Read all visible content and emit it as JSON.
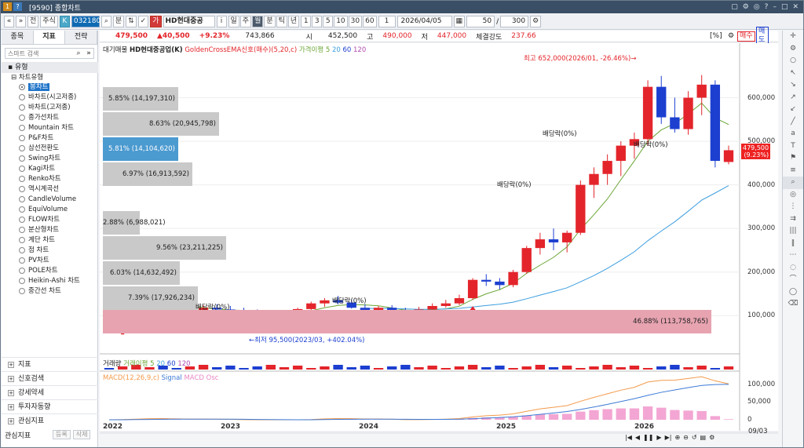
{
  "window": {
    "title": "[9590] 종합차트",
    "title_icons": [
      "restore-icon",
      "options-icon",
      "snapshot-icon",
      "help-icon",
      "minimize-icon",
      "maximize-icon",
      "close-icon"
    ]
  },
  "toolbar": {
    "nav_prev": "«",
    "nav_next": "»",
    "market1": "전",
    "market2": "주식",
    "k_badge": "K",
    "code": "032180",
    "search_icon": "⌕",
    "btn_prev": "분",
    "btn_updown": "⇅",
    "chk_icon": "✓",
    "name_badge": "가",
    "stock_name": "HD현대중공",
    "info_icon": "i",
    "periods": [
      "일",
      "주",
      "월",
      "분",
      "틱",
      "년"
    ],
    "active_period": "월",
    "intervals": [
      "1",
      "3",
      "5",
      "10",
      "30",
      "60"
    ],
    "count_sel": "1",
    "date": "2026/04/05",
    "qty": "50",
    "slash": "/",
    "max_bars": "300",
    "settings_icon": "⚙"
  },
  "left_pane": {
    "tabs": [
      "종목",
      "지표",
      "전략"
    ],
    "active_tab": "지표",
    "search_placeholder": "스마트 검색",
    "tree_header": "유형",
    "tree_group": "차트유형",
    "items": [
      "봉차트",
      "바차트(시고저종)",
      "바차트(고저종)",
      "종가선차트",
      "Mountain 차트",
      "P&F차트",
      "삼선전환도",
      "Swing차트",
      "Kagi차트",
      "Renko차트",
      "역시계곡선",
      "CandleVolume",
      "EquiVolume",
      "FLOW차트",
      "분산형차트",
      "계단 차트",
      "점 차트",
      "PV차트",
      "POLE차트",
      "Heikin-Ashi 차트",
      "중간선 차트"
    ],
    "selected_item": "봉차트",
    "sections": [
      "지표",
      "신호검색",
      "강세약세",
      "투자자동향",
      "관심지표"
    ],
    "fav_label": "관심지표",
    "fav_add": "등록",
    "fav_del": "삭제"
  },
  "quote": {
    "price": "479,500",
    "change": "▲40,500",
    "pct": "+9.23%",
    "volume": "743,866",
    "open_label": "시",
    "open": "452,500",
    "high_label": "고",
    "high": "490,000",
    "low_label": "저",
    "low": "447,000",
    "strength_label": "체결강도",
    "strength": "237.66",
    "ratio_btn": "[%]",
    "buy_btn": "매수",
    "sell_btn": "매도"
  },
  "legend": {
    "main": [
      "대기매물",
      "HD현대중공업(K)",
      "GoldenCrossEMA신호(매수)(5,20,c)",
      "가격이평 5",
      "20",
      "60",
      "120"
    ],
    "vol": [
      "거래량",
      "거래이평 5",
      "20",
      "60",
      "120"
    ],
    "macd": [
      "MACD(12,26,9,c)",
      "Signal",
      "MACD Osc"
    ]
  },
  "colors": {
    "up": "#e3252b",
    "down": "#1c3fd0",
    "ma5": "#6aa534",
    "ma20": "#3d9ee0",
    "macd": "#f39a4b",
    "signal": "#3d7ad6",
    "osc": "#f3a6d3",
    "volume_profile": "#c9c9c9",
    "volume_profile_highlight": "#e7a3b0"
  },
  "annotations": {
    "high": "최고 652,000(2026/01, -26.46%)→",
    "low": "←최저 95,500(2023/03, +402.04%)",
    "div1": "배당락(0%)",
    "div2": "배당락(0%)",
    "div3": "배당락(0%)",
    "div4": "배당락(0%)",
    "div5": "배당락(0%)",
    "price_tag_value": "479,500",
    "price_tag_pct": "(9.23%)"
  },
  "volume_profile": [
    {
      "label": "5.85% (14,197,310)"
    },
    {
      "label": "8.63% (20,945,798)"
    },
    {
      "label": "5.81% (14,104,620)"
    },
    {
      "label": "6.97% (16,913,592)"
    },
    {
      "label": "2.88% (6,988,021)"
    },
    {
      "label": "9.56% (23,211,225)"
    },
    {
      "label": "6.03% (14,632,492)"
    },
    {
      "label": "7.39% (17,926,234)"
    },
    {
      "label": "46.88% (113,758,765)"
    }
  ],
  "axis": {
    "price_ticks": [
      "600,000",
      "500,000",
      "400,000",
      "300,000",
      "200,000",
      "100,000"
    ],
    "macd_ticks": [
      "100,000",
      "50,000",
      "0"
    ],
    "x_labels": [
      "2022",
      "2023",
      "2024",
      "2025",
      "2026"
    ],
    "last_date": "09/03",
    "cursor_date": "09/03"
  },
  "chart_data": {
    "type": "candlestick",
    "period": "monthly",
    "ylim": [
      50000,
      700000
    ],
    "candles": [
      [
        120000,
        140000,
        100000,
        110000
      ],
      [
        110000,
        125000,
        100000,
        118000
      ],
      [
        118000,
        130000,
        110000,
        125000
      ],
      [
        125000,
        140000,
        115000,
        130000
      ],
      [
        130000,
        142000,
        118000,
        122000
      ],
      [
        122000,
        132000,
        105000,
        110000
      ],
      [
        110000,
        120000,
        102000,
        112000
      ],
      [
        112000,
        124000,
        106000,
        118000
      ],
      [
        118000,
        126000,
        108000,
        114000
      ],
      [
        114000,
        122000,
        105000,
        110000
      ],
      [
        110000,
        118000,
        102000,
        106000
      ],
      [
        106000,
        114000,
        98000,
        100000
      ],
      [
        100000,
        108000,
        95500,
        104000
      ],
      [
        104000,
        112000,
        98000,
        108000
      ],
      [
        108000,
        118000,
        102000,
        115000
      ],
      [
        115000,
        132000,
        110000,
        128000
      ],
      [
        128000,
        140000,
        120000,
        135000
      ],
      [
        135000,
        145000,
        126000,
        130000
      ],
      [
        130000,
        136000,
        116000,
        118000
      ],
      [
        118000,
        126000,
        108000,
        112000
      ],
      [
        112000,
        122000,
        104000,
        118000
      ],
      [
        118000,
        124000,
        106000,
        110000
      ],
      [
        110000,
        118000,
        100000,
        104000
      ],
      [
        104000,
        120000,
        100000,
        114000
      ],
      [
        114000,
        128000,
        110000,
        122000
      ],
      [
        122000,
        136000,
        118000,
        128000
      ],
      [
        128000,
        148000,
        124000,
        140000
      ],
      [
        140000,
        186000,
        136000,
        182000
      ],
      [
        182000,
        195000,
        168000,
        178000
      ],
      [
        178000,
        186000,
        160000,
        170000
      ],
      [
        170000,
        205000,
        165000,
        200000
      ],
      [
        200000,
        260000,
        196000,
        255000
      ],
      [
        255000,
        290000,
        240000,
        275000
      ],
      [
        275000,
        300000,
        250000,
        268000
      ],
      [
        268000,
        295000,
        245000,
        290000
      ],
      [
        290000,
        410000,
        285000,
        400000
      ],
      [
        400000,
        440000,
        370000,
        425000
      ],
      [
        425000,
        470000,
        400000,
        455000
      ],
      [
        455000,
        500000,
        420000,
        490000
      ],
      [
        490000,
        520000,
        460000,
        505000
      ],
      [
        505000,
        640000,
        490000,
        625000
      ],
      [
        625000,
        650000,
        540000,
        555000
      ],
      [
        555000,
        600000,
        520000,
        528000
      ],
      [
        528000,
        615000,
        515000,
        600000
      ],
      [
        600000,
        652000,
        560000,
        630000
      ],
      [
        630000,
        640000,
        440000,
        455000
      ],
      [
        452500,
        490000,
        447000,
        479500
      ]
    ]
  }
}
